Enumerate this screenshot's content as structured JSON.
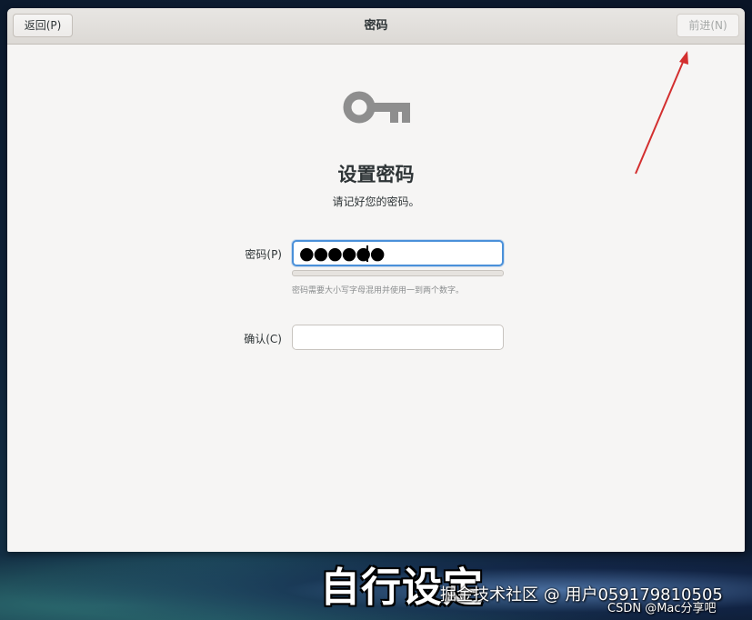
{
  "headerbar": {
    "title": "密码",
    "back_label": "返回(P)",
    "next_label": "前进(N)"
  },
  "page": {
    "icon": "key-icon",
    "heading": "设置密码",
    "subtitle": "请记好您的密码。"
  },
  "password_field": {
    "label": "密码(P)",
    "value": "●●●●●●",
    "strength_fraction": 0,
    "hint": "密码需要大小写字母混用并使用一到两个数字。"
  },
  "confirm_field": {
    "label": "确认(C)",
    "value": ""
  },
  "overlay": {
    "caption": "自行设定",
    "watermark_primary": "掘金技术社区 @ 用户059179810505",
    "watermark_secondary": "CSDN @Mac分享吧",
    "arrow_color": "#d32f2f"
  },
  "colors": {
    "accent": "#4a90d9",
    "window_bg": "#f6f5f4",
    "icon": "#8e8e8e"
  }
}
